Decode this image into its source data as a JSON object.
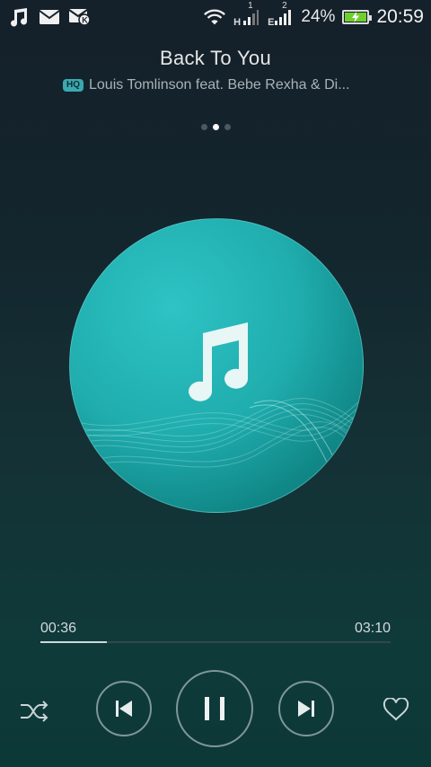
{
  "status_bar": {
    "network_1_type": "H",
    "network_1_sim": "1",
    "network_2_type": "E",
    "network_2_sim": "2",
    "battery_percent": "24%",
    "time": "20:59",
    "icons": [
      "music-note-icon",
      "mail-icon",
      "mail-k-icon",
      "wifi-icon",
      "signal-icon",
      "signal-icon",
      "battery-charging-icon"
    ]
  },
  "player": {
    "title": "Back To You",
    "quality_badge": "HQ",
    "artist": "Louis Tomlinson feat. Bebe Rexha & Di...",
    "page_dots": 3,
    "active_page": 1,
    "elapsed": "00:36",
    "duration": "03:10",
    "progress_fraction": 0.19
  },
  "controls": {
    "shuffle": "shuffle-icon",
    "previous": "skip-previous-icon",
    "play_pause": "pause-icon",
    "next": "skip-next-icon",
    "favorite": "heart-icon"
  },
  "colors": {
    "accent": "#2ec3c4",
    "battery_fill": "#6fcf2f"
  }
}
